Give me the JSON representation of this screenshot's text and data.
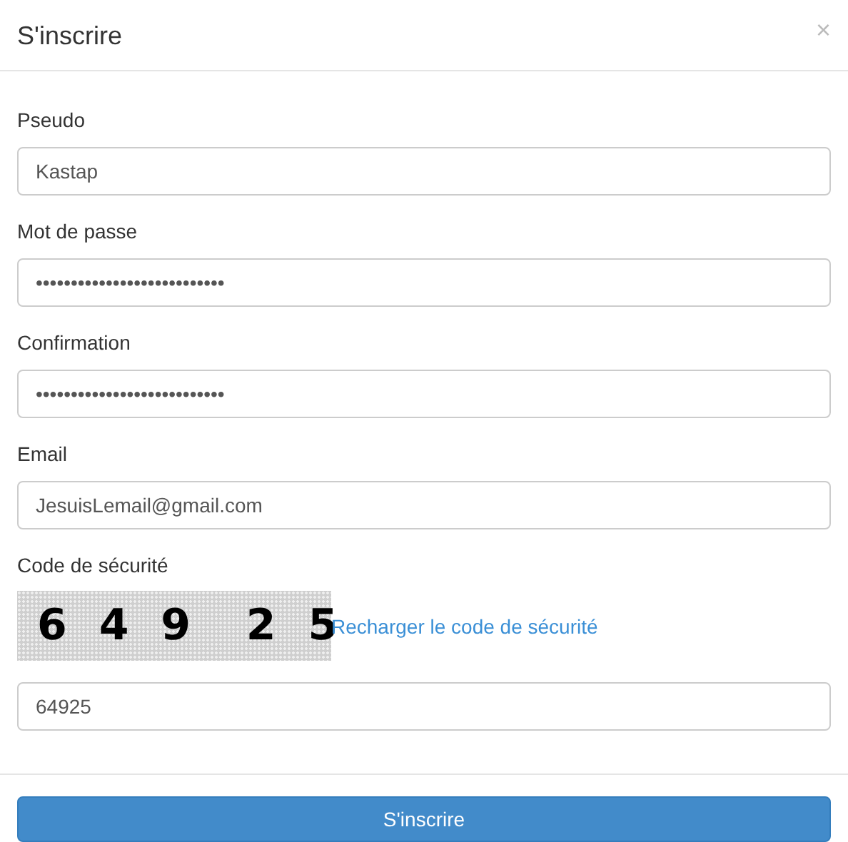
{
  "dialog": {
    "title": "S'inscrire",
    "close": "×"
  },
  "fields": [
    {
      "label": "Pseudo",
      "value": "Kastap"
    },
    {
      "label": "Mot de passe",
      "value": "•••••••••••••••••••••••••••"
    },
    {
      "label": "Confirmation",
      "value": "•••••••••••••••••••••••••••"
    },
    {
      "label": "Email",
      "value": "JesuisLemail@gmail.com"
    }
  ],
  "captcha": {
    "label": "Code de sécurité",
    "code": "6 4 9  2 5",
    "reload_link": "Recharger le code de sécurité",
    "value": "64925"
  },
  "submit": "S'inscrire"
}
